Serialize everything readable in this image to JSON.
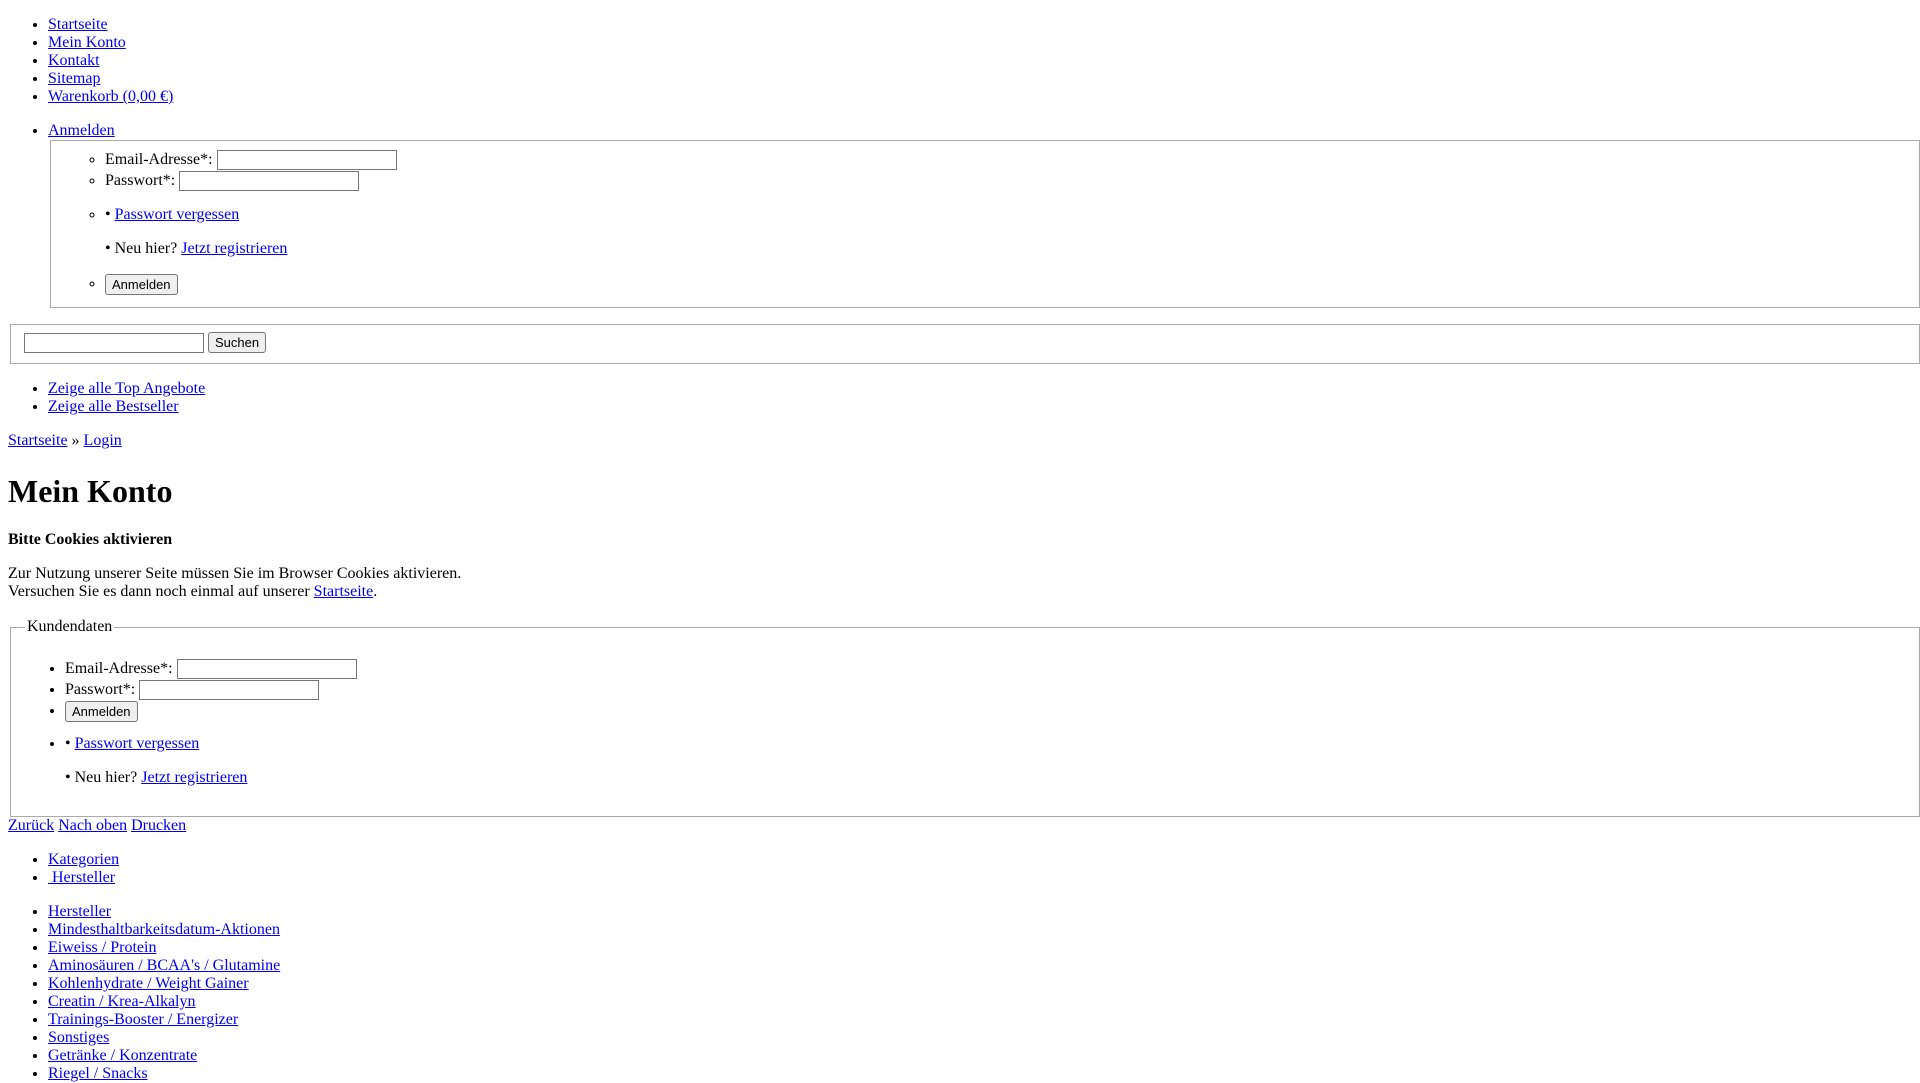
{
  "top_nav": [
    {
      "label": "Startseite"
    },
    {
      "label": "Mein Konto"
    },
    {
      "label": "Kontakt"
    },
    {
      "label": "Sitemap"
    },
    {
      "label": "Warenkorb (0,00 €)"
    }
  ],
  "login_box": {
    "toggle_label": "Anmelden",
    "email_label": "Email-Adresse*:",
    "email_value": "",
    "password_label": "Passwort*:",
    "password_value": "",
    "bullet": "•",
    "forgot_label": "Passwort vergessen",
    "new_here_prefix": "• Neu hier?",
    "register_label": "Jetzt registrieren",
    "submit_label": "Anmelden"
  },
  "search": {
    "value": "",
    "button_label": "Suchen"
  },
  "offer_links": [
    {
      "label": "Zeige alle Top Angebote"
    },
    {
      "label": "Zeige alle Bestseller"
    }
  ],
  "breadcrumb": {
    "home": "Startseite",
    "separator": "»",
    "current": "Login"
  },
  "page_title": "Mein Konto",
  "cookie_notice": {
    "heading": "Bitte Cookies aktivieren",
    "line1": "Zur Nutzung unserer Seite müssen Sie im Browser Cookies aktivieren.",
    "line2_prefix": "Versuchen Sie es dann noch einmal auf unserer",
    "line2_link": "Startseite",
    "line2_suffix": "."
  },
  "customer_form": {
    "legend": "Kundendaten",
    "email_label": "Email-Adresse*:",
    "email_value": "",
    "password_label": "Passwort*:",
    "password_value": "",
    "submit_label": "Anmelden",
    "bullet": "•",
    "forgot_label": "Passwort vergessen",
    "new_here_prefix": "• Neu hier?",
    "register_label": "Jetzt registrieren"
  },
  "page_actions": {
    "back": "Zurück",
    "top": "Nach oben",
    "print": "Drucken"
  },
  "side_tabs": [
    {
      "label": "Kategorien"
    },
    {
      "label": " Hersteller"
    }
  ],
  "categories": [
    {
      "label": "Hersteller"
    },
    {
      "label": "Mindesthaltbarkeitsdatum-Aktionen"
    },
    {
      "label": "Eiweiss / Protein"
    },
    {
      "label": "Aminosäuren / BCAA's / Glutamine"
    },
    {
      "label": "Kohlenhydrate / Weight Gainer"
    },
    {
      "label": "Creatin / Krea-Alkalyn"
    },
    {
      "label": "Trainings-Booster / Energizer"
    },
    {
      "label": "Sonstiges"
    },
    {
      "label": "Getränke / Konzentrate"
    },
    {
      "label": "Riegel / Snacks"
    }
  ]
}
